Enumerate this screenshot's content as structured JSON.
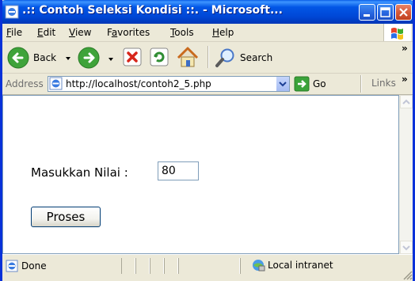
{
  "window": {
    "title": ".:: Contoh Seleksi Kondisi ::. - Microsoft..."
  },
  "menu": {
    "items": [
      {
        "accel": "F",
        "rest": "ile"
      },
      {
        "accel": "E",
        "rest": "dit"
      },
      {
        "accel": "V",
        "rest": "iew"
      },
      {
        "pre": "F",
        "accel": "a",
        "rest": "vorites"
      },
      {
        "accel": "T",
        "rest": "ools"
      },
      {
        "accel": "H",
        "rest": "elp"
      }
    ]
  },
  "toolbar": {
    "back_label": "Back",
    "search_label": "Search",
    "overflow": "»"
  },
  "address": {
    "label": "Address",
    "url": "http://localhost/contoh2_5.php",
    "go_label": "Go",
    "links_label": "Links",
    "overflow": "»"
  },
  "form": {
    "label": "Masukkan Nilai :",
    "value": "80",
    "submit_label": "Proses"
  },
  "status": {
    "text": "Done",
    "zone": "Local intranet"
  },
  "colors": {
    "titlebar": "#0054e3",
    "accent": "#0831d9",
    "chrome": "#ece9d8"
  }
}
